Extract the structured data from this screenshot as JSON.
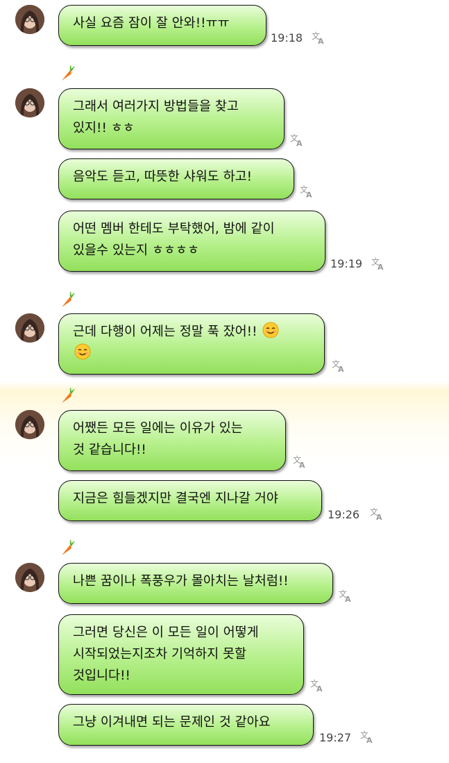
{
  "chat": {
    "messages": [
      {
        "lines": [
          "사실 요즘 잠이 잘 안와!!ㅠㅠ"
        ],
        "time": "19:18"
      },
      {
        "lines": [
          "그래서 여러가지 방법들을 찾고",
          "있지!! ㅎㅎ"
        ],
        "time": ""
      },
      {
        "lines": [
          "음악도 듣고, 따뜻한 샤워도 하고!"
        ],
        "time": ""
      },
      {
        "lines": [
          "어떤 멤버 한테도 부탁했어, 밤에 같이",
          "있을수 있는지 ㅎㅎㅎㅎ"
        ],
        "time": "19:19"
      },
      {
        "lines": [
          "근데 다행이 어제는 정말 푹 잤어!!",
          ""
        ],
        "time": ""
      },
      {
        "lines": [
          "어쨌든 모든 일에는 이유가 있는",
          "것 같습니다!!"
        ],
        "time": ""
      },
      {
        "lines": [
          "지금은 힘들겠지만 결국엔 지나갈 거야"
        ],
        "time": "19:26"
      },
      {
        "lines": [
          "나쁜 꿈이나 폭풍우가 몰아치는 날처럼!!"
        ],
        "time": ""
      },
      {
        "lines": [
          "그러면 당신은 이 모든 일이 어떻게",
          "시작되었는지조차 기억하지 못할",
          "것입니다!!"
        ],
        "time": ""
      },
      {
        "lines": [
          "그냥 이겨내면 되는 문제인 것 같아요"
        ],
        "time": "19:27"
      }
    ]
  },
  "colors": {
    "bubble_top": "#e9fdd9",
    "bubble_bottom": "#93e05c",
    "border": "#111111",
    "time_text": "#444444"
  },
  "icons": {
    "avatar": "profile-photo",
    "carrot": "carrot-emoji",
    "translate": "translate-icon",
    "smiley": "smiling-face-emoji"
  }
}
